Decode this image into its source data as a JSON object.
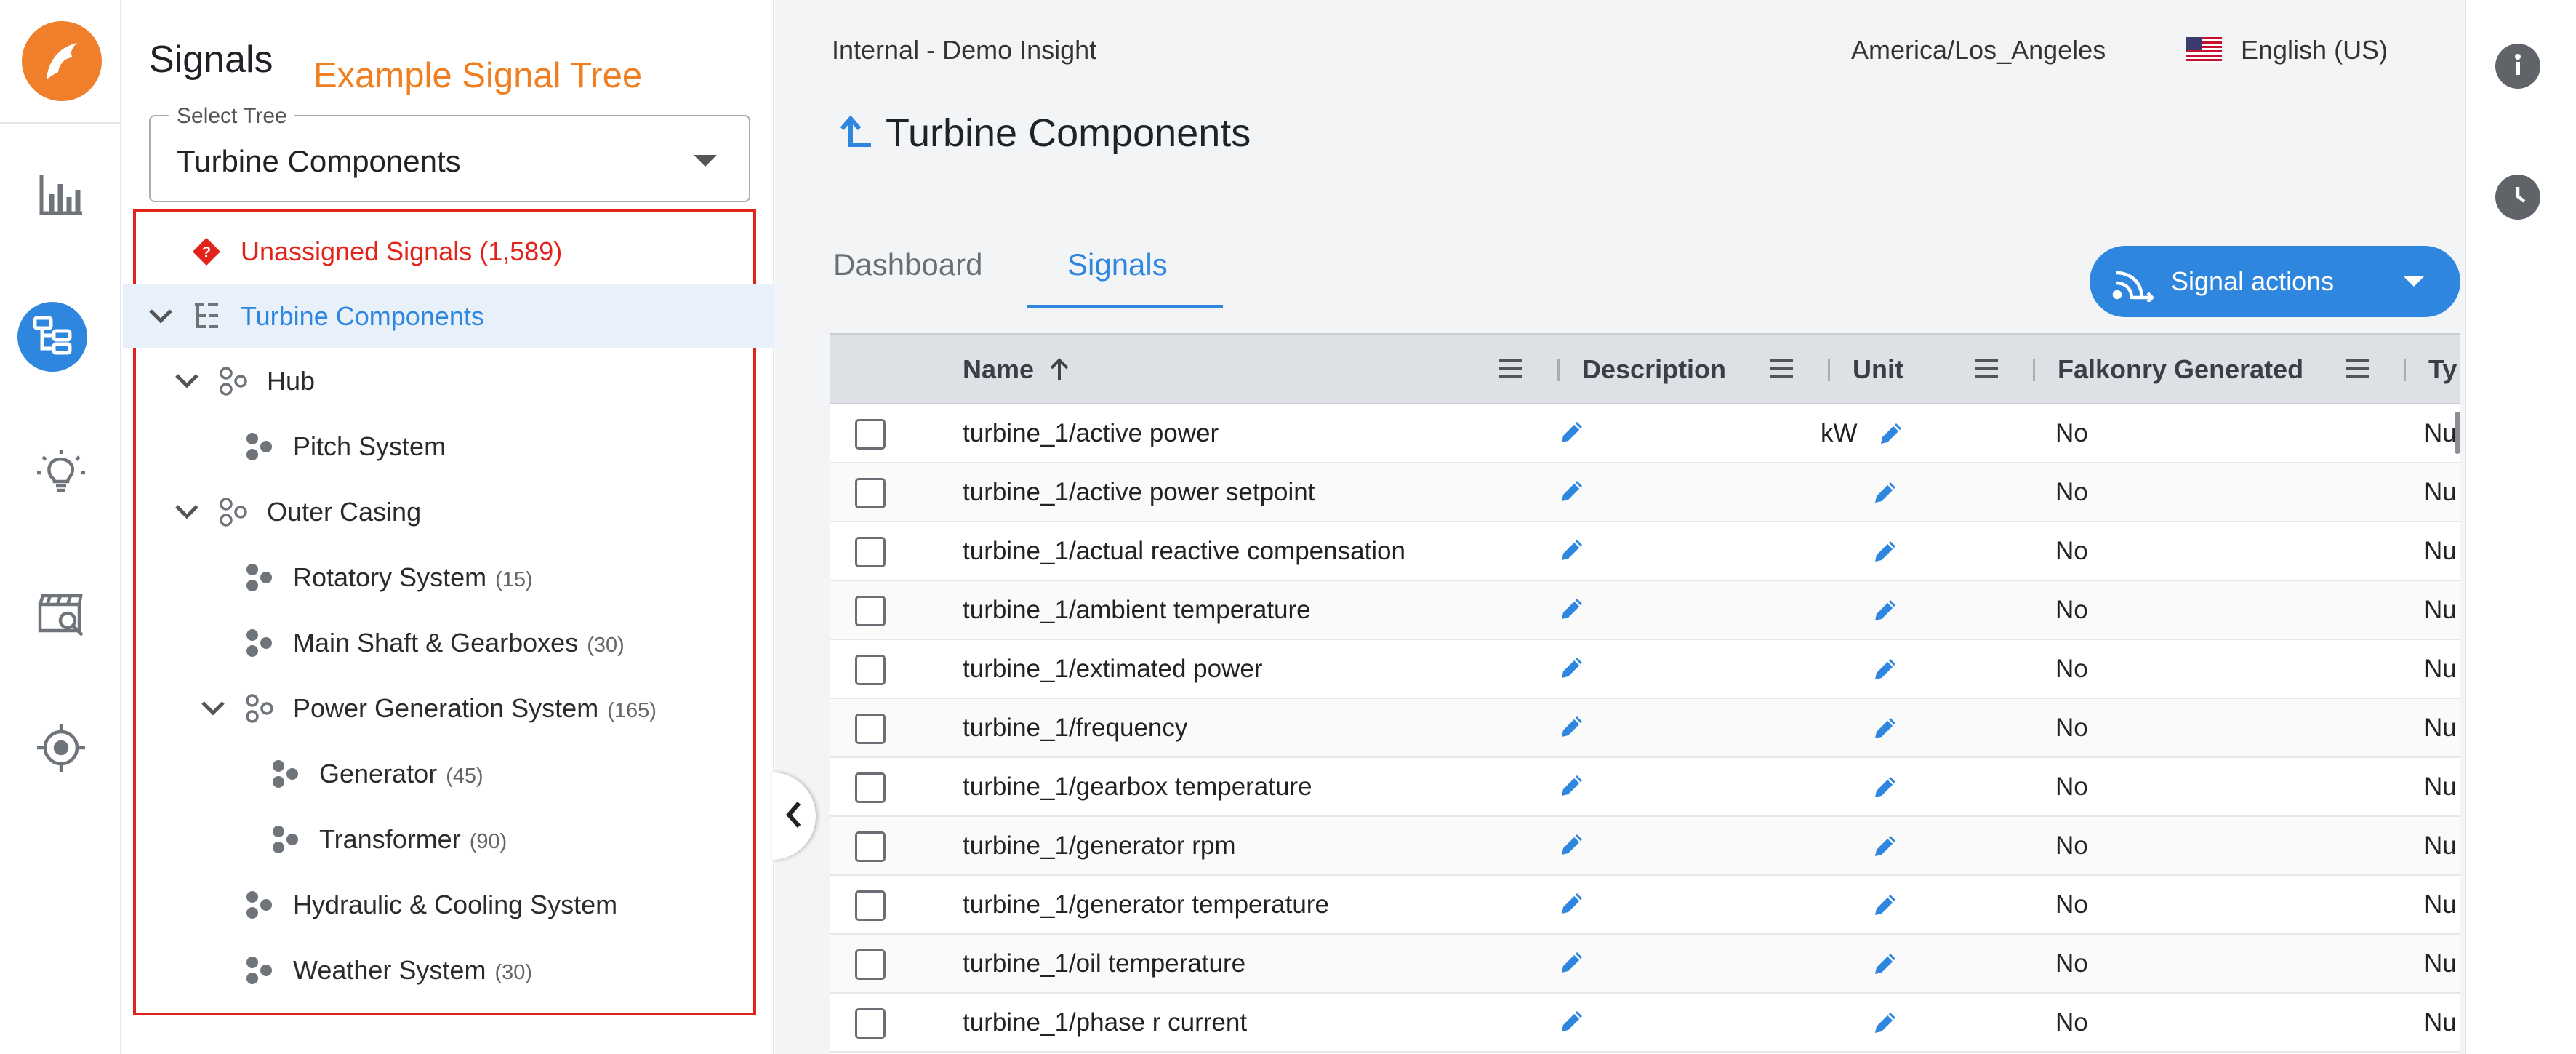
{
  "sidebar": {
    "items": [
      {
        "name": "analytics",
        "icon": "bar-chart-icon"
      },
      {
        "name": "signal-tree",
        "icon": "hierarchy-icon",
        "active": true
      },
      {
        "name": "insights",
        "icon": "lightbulb-icon"
      },
      {
        "name": "explorer",
        "icon": "clapperboard-search-icon"
      },
      {
        "name": "targets",
        "icon": "crosshair-icon"
      }
    ],
    "logo_icon": "falkonry-logo-icon",
    "accent_color": "#2f86df",
    "logo_color": "#f07f2b"
  },
  "tree_panel": {
    "title": "Signals",
    "annotation": "Example Signal Tree",
    "select": {
      "legend": "Select Tree",
      "value": "Turbine Components"
    },
    "nodes": [
      {
        "label": "Unassigned Signals (1,589)",
        "count": "",
        "icon": "unassigned-icon",
        "chevron": false
      },
      {
        "label": "Turbine Components",
        "count": "",
        "icon": "tree-root-icon",
        "chevron": true
      },
      {
        "label": "Hub",
        "count": "",
        "icon": "group-node-icon",
        "chevron": true
      },
      {
        "label": "Pitch System",
        "count": "",
        "icon": "leaf-node-icon",
        "chevron": false
      },
      {
        "label": "Outer Casing",
        "count": "",
        "icon": "group-node-icon",
        "chevron": true
      },
      {
        "label": "Rotatory System",
        "count": "(15)",
        "icon": "leaf-node-icon",
        "chevron": false
      },
      {
        "label": "Main Shaft & Gearboxes",
        "count": "(30)",
        "icon": "leaf-node-icon",
        "chevron": false
      },
      {
        "label": "Power Generation System",
        "count": "(165)",
        "icon": "group-node-icon",
        "chevron": true
      },
      {
        "label": "Generator",
        "count": "(45)",
        "icon": "leaf-node-icon",
        "chevron": false
      },
      {
        "label": "Transformer",
        "count": "(90)",
        "icon": "leaf-node-icon",
        "chevron": false
      },
      {
        "label": "Hydraulic & Cooling System",
        "count": "",
        "icon": "leaf-node-icon",
        "chevron": false
      },
      {
        "label": "Weather System",
        "count": "(30)",
        "icon": "leaf-node-icon",
        "chevron": false
      }
    ]
  },
  "header": {
    "workspace": "Internal - Demo Insight",
    "timezone": "America/Los_Angeles",
    "language": "English (US)",
    "title": "Turbine Components"
  },
  "tabs": [
    {
      "label": "Dashboard",
      "active": false
    },
    {
      "label": "Signals",
      "active": true
    }
  ],
  "signal_actions": {
    "label": "Signal actions",
    "icon": "signal-broadcast-icon"
  },
  "grid": {
    "columns": [
      "Name",
      "Description",
      "Unit",
      "Falkonry Generated",
      "Ty"
    ],
    "rows": [
      {
        "name": "turbine_1/active power",
        "unit": "kW",
        "generated": "No",
        "type": "Nu"
      },
      {
        "name": "turbine_1/active power setpoint",
        "unit": "",
        "generated": "No",
        "type": "Nu"
      },
      {
        "name": "turbine_1/actual reactive compensation",
        "unit": "",
        "generated": "No",
        "type": "Nu"
      },
      {
        "name": "turbine_1/ambient temperature",
        "unit": "",
        "generated": "No",
        "type": "Nu"
      },
      {
        "name": "turbine_1/extimated power",
        "unit": "",
        "generated": "No",
        "type": "Nu"
      },
      {
        "name": "turbine_1/frequency",
        "unit": "",
        "generated": "No",
        "type": "Nu"
      },
      {
        "name": "turbine_1/gearbox temperature",
        "unit": "",
        "generated": "No",
        "type": "Nu"
      },
      {
        "name": "turbine_1/generator rpm",
        "unit": "",
        "generated": "No",
        "type": "Nu"
      },
      {
        "name": "turbine_1/generator temperature",
        "unit": "",
        "generated": "No",
        "type": "Nu"
      },
      {
        "name": "turbine_1/oil temperature",
        "unit": "",
        "generated": "No",
        "type": "Nu"
      },
      {
        "name": "turbine_1/phase r current",
        "unit": "",
        "generated": "No",
        "type": "Nu"
      }
    ]
  },
  "right_rail": {
    "items": [
      {
        "icon": "info-icon"
      },
      {
        "icon": "clock-icon"
      }
    ]
  }
}
